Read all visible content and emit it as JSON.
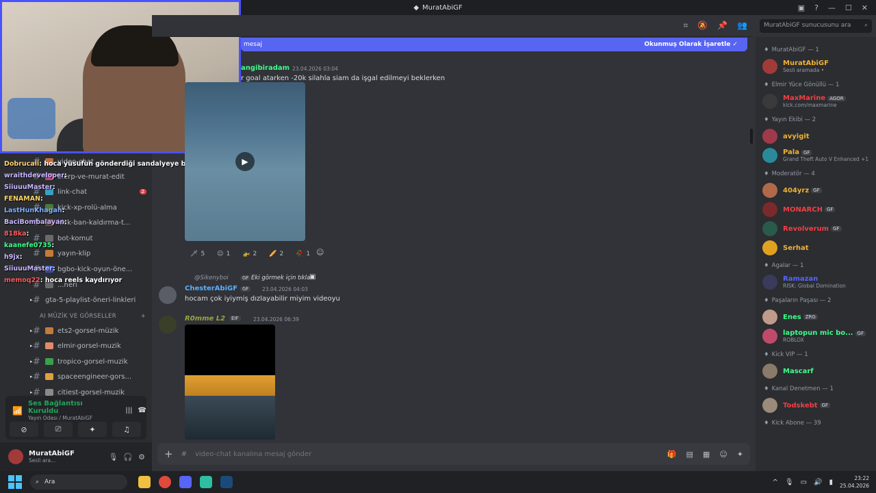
{
  "window": {
    "title": "MuratAbiGF"
  },
  "search": {
    "placeholder": "MuratAbiGF sunucusunu ara"
  },
  "banner": {
    "left_text": "mesaj",
    "mark_read": "Okunmuş Olarak İşaretle"
  },
  "stream_overlay": {
    "lines": [
      {
        "user": "Dobrucali",
        "text": ": hoca yusufun gönderdiği sandalyeye bundan çekecek",
        "color": "#ffd166"
      },
      {
        "user": "wraithdeveloper",
        "text": ":",
        "color": "#c8b6ff"
      },
      {
        "user": "SiiuuuMaster",
        "text": ":",
        "color": "#c8b6ff"
      },
      {
        "user": "FENAMAN",
        "text": ":",
        "color": "#ffd166"
      },
      {
        "user": "LastHunKhagan",
        "text": ":",
        "color": "#7fb2ff"
      },
      {
        "user": "BaciBombalayan",
        "text": ":",
        "color": "#c8b6ff"
      },
      {
        "user": "818ka",
        "text": ":",
        "color": "#ff5a5a"
      },
      {
        "user": "kaanefe0735",
        "text": ":",
        "color": "#3cff8a"
      },
      {
        "user": "h9jx",
        "text": ":",
        "color": "#c8b6ff"
      },
      {
        "user": "SiiuuuMaster",
        "text": ":",
        "color": "#c8b6ff"
      },
      {
        "user": "memoq22",
        "text": ": hoca reels kaydırıyor",
        "color": "#ff5a5a"
      }
    ]
  },
  "channels": [
    {
      "name": "video-chat"
    },
    {
      "name": "blerp-ve-murat-edit"
    },
    {
      "name": "link-chat",
      "badge": "2"
    },
    {
      "name": "kick-xp-rolü-alma"
    },
    {
      "name": "kick-ban-kaldırma-t..."
    },
    {
      "name": "bot-komut"
    },
    {
      "name": "yayın-klip"
    },
    {
      "name": "bgbo-kick-oyun-öne..."
    },
    {
      "name": "...neri"
    },
    {
      "name": "gta-5-playlist-öneri-linkleri"
    }
  ],
  "category": {
    "name": "AI MÜZİK VE GÖRSELLER",
    "add": "+"
  },
  "ai_channels": [
    {
      "name": "ets2-gorsel-müzik"
    },
    {
      "name": "elmir-gorsel-muzik"
    },
    {
      "name": "tropico-gorsel-muzik"
    },
    {
      "name": "spaceengineer-gors..."
    },
    {
      "name": "citiest-gorsel-muzik"
    }
  ],
  "voice": {
    "status": "Ses Bağlantısı Kuruldu",
    "room": "Yayın Odası / MuratAbiGF"
  },
  "user": {
    "name": "MuratAbiGF",
    "status": "Sesli ara..."
  },
  "messages": {
    "m1": {
      "author": "angibiradam",
      "time": "23.04.2026 03:04",
      "text": "r goal atarken -20k silahla siam da işgal edilmeyi beklerken"
    },
    "reactions": [
      {
        "emoji": "🗡",
        "count": "5"
      },
      {
        "emoji": "😐",
        "count": "1"
      },
      {
        "emoji": "🚁",
        "count": "2"
      },
      {
        "emoji": "🥖",
        "count": "2"
      },
      {
        "emoji": "🥀",
        "count": "1"
      }
    ],
    "reply": {
      "author": "@Sikenyboi",
      "tag": "GF",
      "text": "Eki görmek için tıkla"
    },
    "m2": {
      "author": "ChesterAbiGF",
      "tag": "GF",
      "time": "23.04.2026 04:03",
      "text": "hocam çok iyiymiş dızlayabilir miyim videoyu"
    },
    "m3": {
      "author": "R0mme L2",
      "tag": "EIF",
      "time": "23.04.2026 06:39"
    }
  },
  "composer": {
    "placeholder": "video-chat kanalına mesaj gönder"
  },
  "members": {
    "groups": [
      {
        "title": "MuratAbiGF — 1",
        "items": [
          {
            "name": "MuratAbiGF",
            "sub": "Sesli aramada •",
            "color": "#f0b232"
          }
        ]
      },
      {
        "title": "Elmir Yüce Gönüllü — 1",
        "items": [
          {
            "name": "MaxMarine",
            "tag": "AGOR",
            "sub": "kick.com/maxmarine",
            "color": "#f23f43"
          }
        ]
      },
      {
        "title": "Yayın Ekibi — 2",
        "items": [
          {
            "name": "avyigit",
            "color": "#f0b232"
          },
          {
            "name": "Pala",
            "tag": "GF",
            "sub": "Grand Theft Auto V Enhanced +1",
            "color": "#f0b232"
          }
        ]
      },
      {
        "title": "Moderatör — 4",
        "items": [
          {
            "name": "404yrz",
            "tag": "GF",
            "color": "#f0b232"
          },
          {
            "name": "MONARCH",
            "tag": "GF",
            "color": "#f23f43"
          },
          {
            "name": "Revolverum",
            "tag": "GF",
            "color": "#f23f43"
          },
          {
            "name": "Serhat",
            "color": "#f0b232"
          }
        ]
      },
      {
        "title": "Agalar — 1",
        "items": [
          {
            "name": "Ramazan",
            "sub": "RISK: Global Domination",
            "color": "#5865f2"
          }
        ]
      },
      {
        "title": "Paşaların Paşası — 2",
        "items": [
          {
            "name": "Enes",
            "tag": "ZRG",
            "color": "#3cff8a"
          },
          {
            "name": "laptopun mic bo...",
            "tag": "GF",
            "sub": "ROBLOX",
            "color": "#3cff8a"
          }
        ]
      },
      {
        "title": "Kick VIP — 1",
        "items": [
          {
            "name": "Mascarf",
            "color": "#3cff8a"
          }
        ]
      },
      {
        "title": "Kanal Denetmen — 1",
        "items": [
          {
            "name": "Todskebt",
            "tag": "GF",
            "color": "#f23f43"
          }
        ]
      },
      {
        "title": "Kick Abone — 39",
        "items": []
      }
    ]
  },
  "taskbar": {
    "search": "Ara",
    "time": "23:22",
    "date": "25.04.2026"
  }
}
